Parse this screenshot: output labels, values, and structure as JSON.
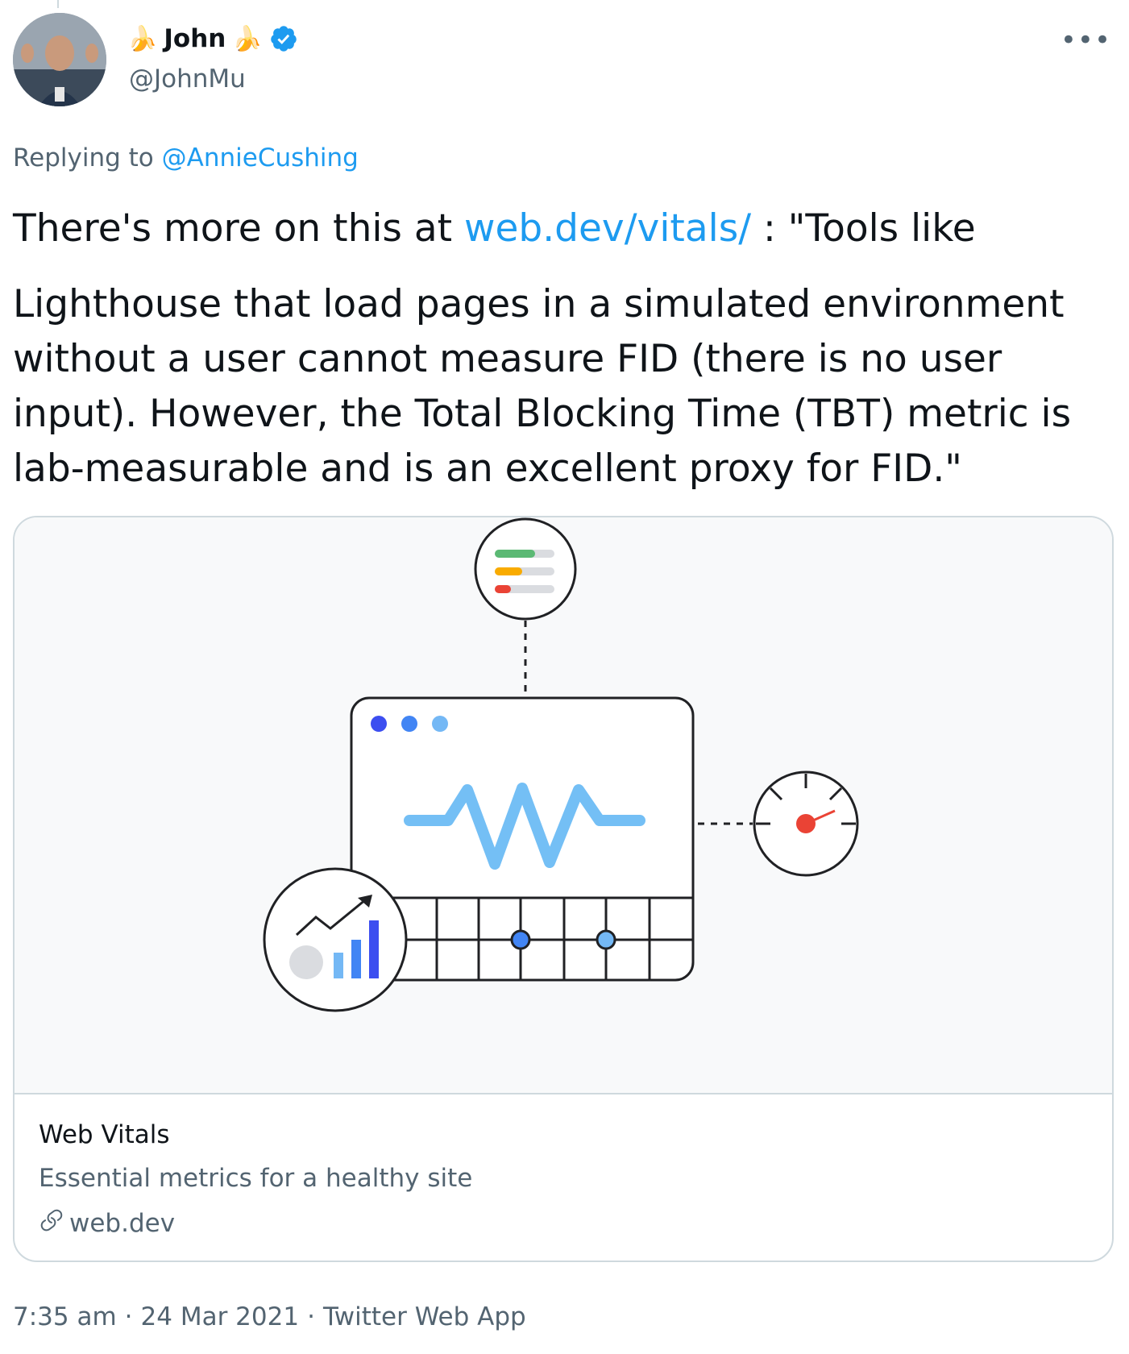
{
  "author": {
    "emoji_left": "🍌",
    "name": "John",
    "emoji_right": "🍌",
    "handle": "@JohnMu"
  },
  "more_label": "•••",
  "reply": {
    "prefix": "Replying to",
    "mention": "@AnnieCushing"
  },
  "tweet": {
    "text_before_link": "There's more on this at ",
    "link_text": "web.dev/vitals/",
    "text_after_link": " : \"Tools like",
    "paragraph2": "Lighthouse that load pages in a simulated environment without a user cannot measure FID (there is no user input). However, the Total Blocking Time (TBT) metric is lab-measurable and is an excellent proxy for FID.\""
  },
  "card": {
    "title": "Web Vitals",
    "description": "Essential metrics for a healthy site",
    "domain": "web.dev"
  },
  "meta": {
    "time": "7:35 am",
    "separator1": "·",
    "date": "24 Mar 2021",
    "separator2": "·",
    "source": "Twitter Web App"
  },
  "colors": {
    "accent": "#1d9bf0",
    "secondary_text": "#536471",
    "border": "#cfd9de",
    "card_bg": "#f8f9fa"
  },
  "icons": [
    "verified-badge-icon",
    "more-icon",
    "link-icon"
  ]
}
